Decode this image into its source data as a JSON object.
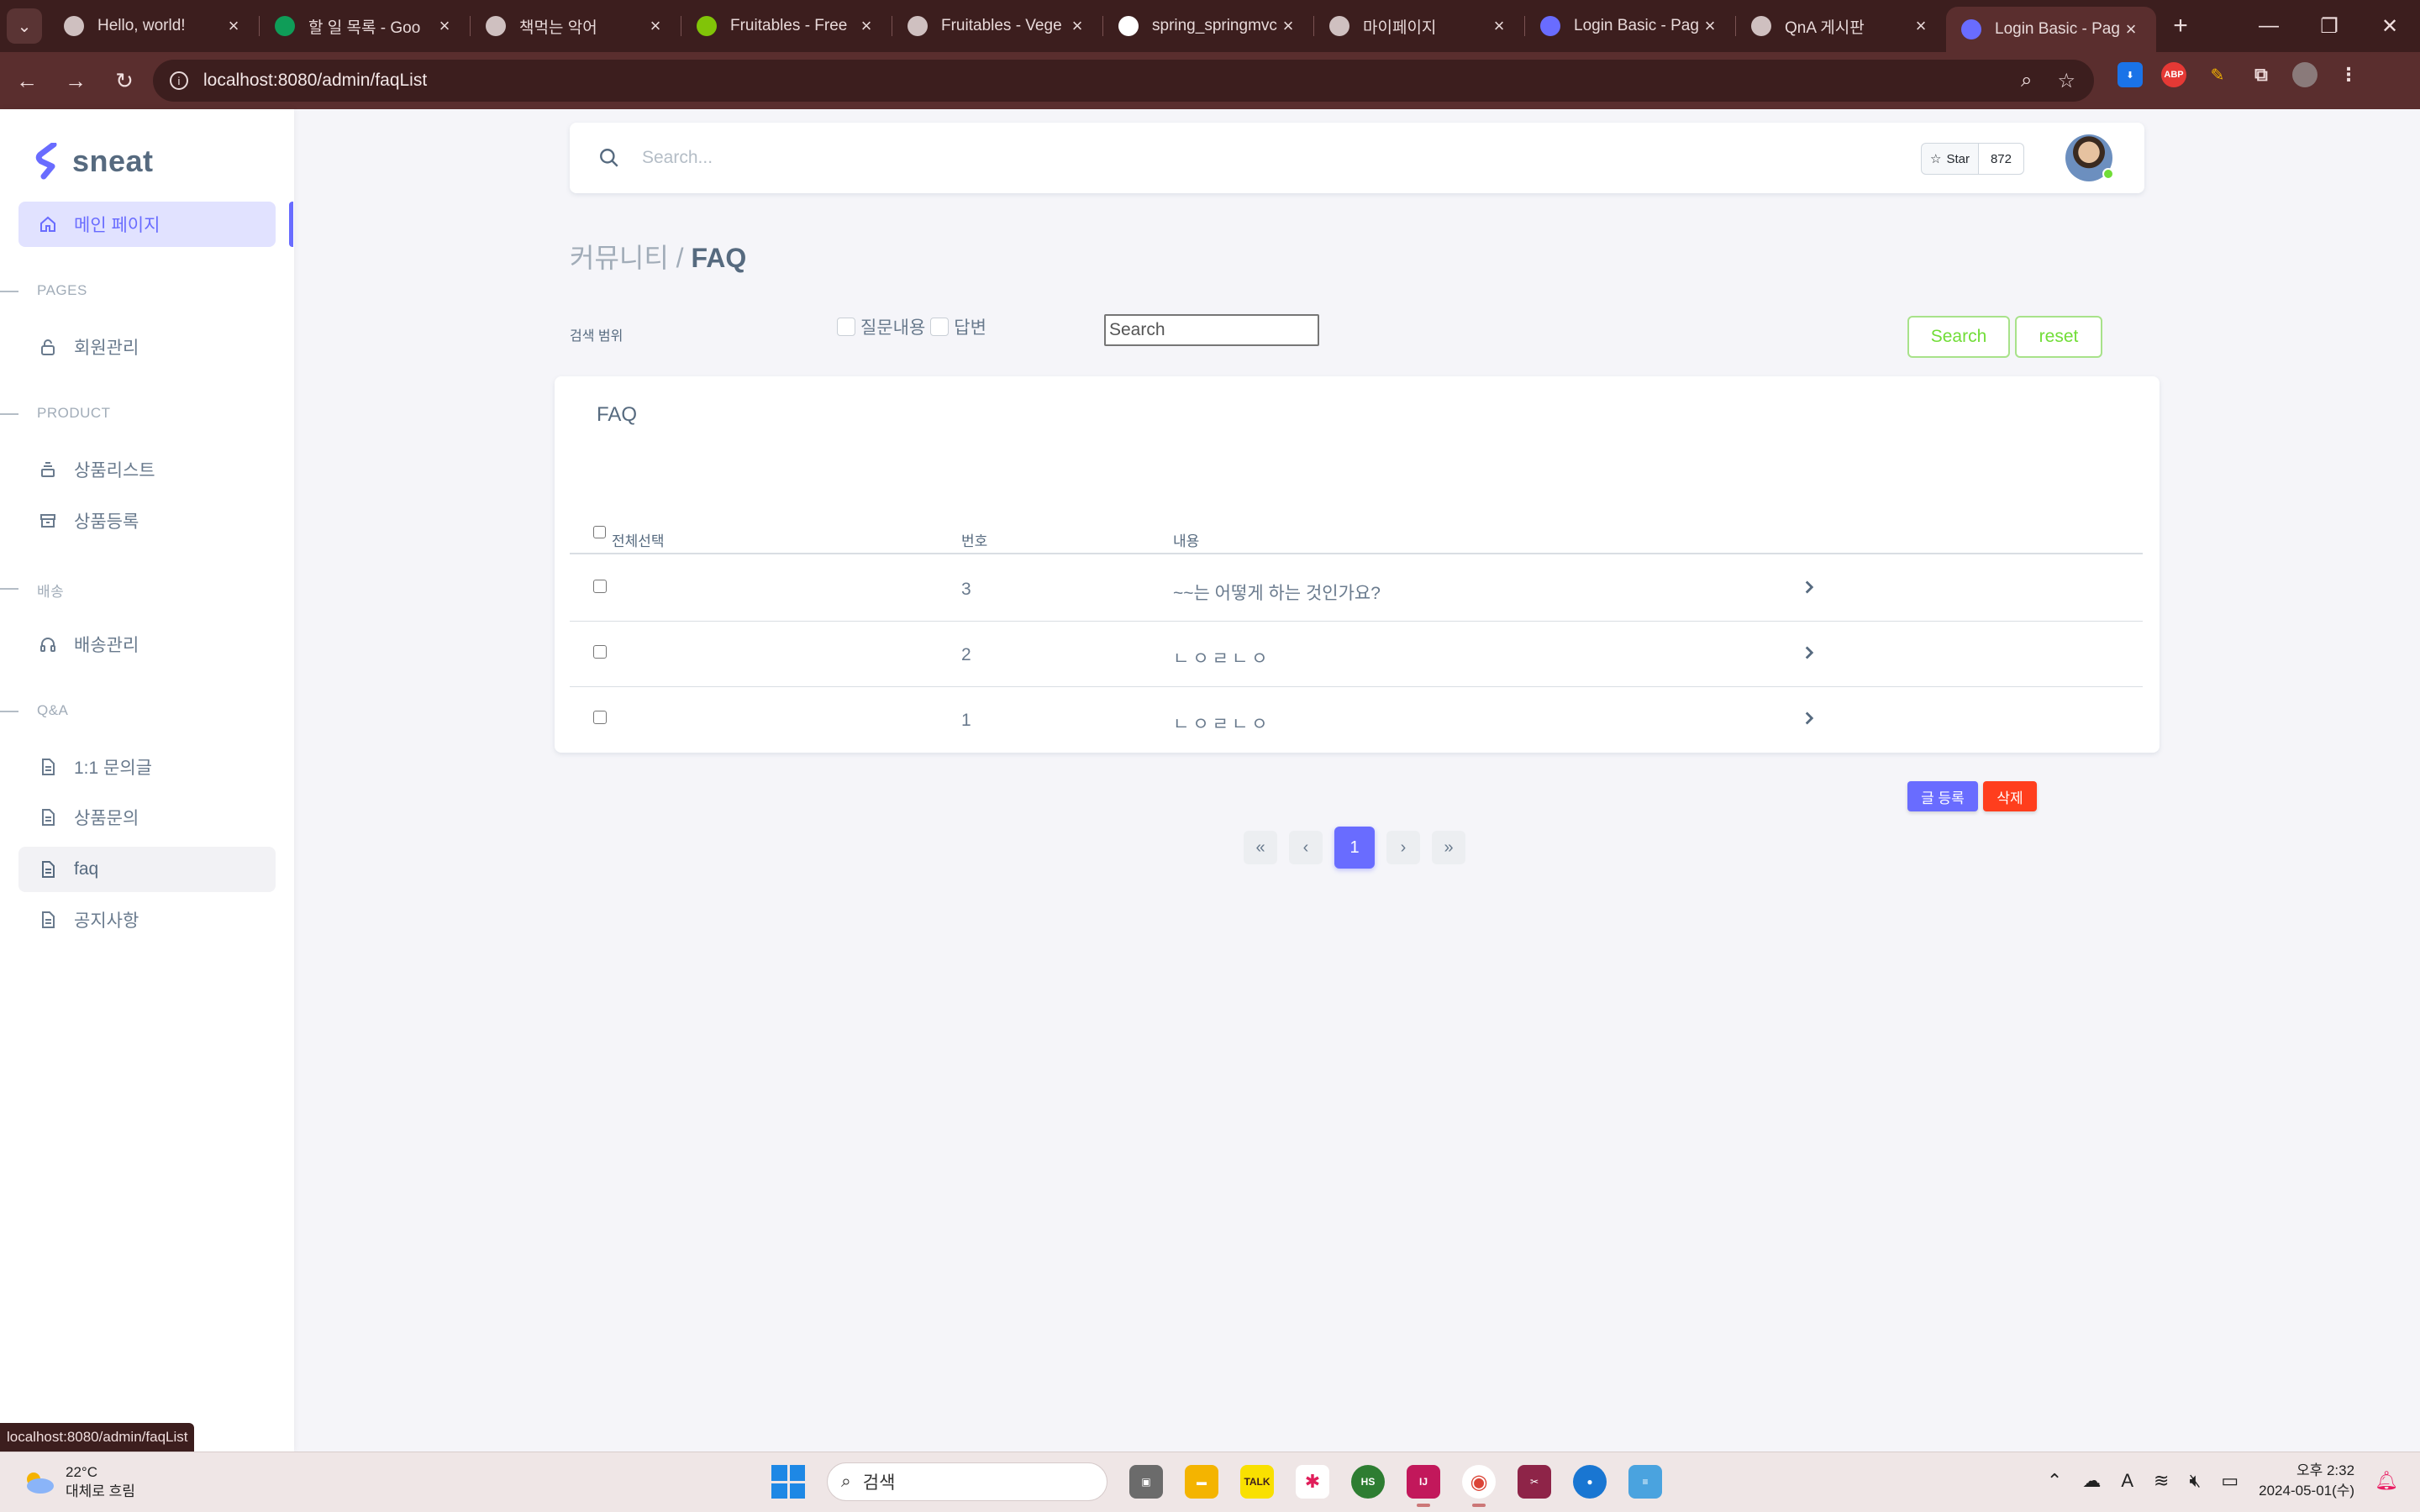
{
  "browser": {
    "tabs": [
      {
        "title": "Hello, world!",
        "icon": "globe-icon",
        "color": "#cfc0c0"
      },
      {
        "title": "할 일 목록 - Goo",
        "icon": "sheets-icon",
        "color": "#0f9d58"
      },
      {
        "title": "책먹는 악어",
        "icon": "globe-icon",
        "color": "#cfc0c0"
      },
      {
        "title": "Fruitables - Free",
        "icon": "leaf-icon",
        "color": "#81c408"
      },
      {
        "title": "Fruitables - Vege",
        "icon": "globe-icon",
        "color": "#cfc0c0"
      },
      {
        "title": "spring_springmvc",
        "icon": "github-icon",
        "color": "#ffffff"
      },
      {
        "title": "마이페이지",
        "icon": "globe-icon",
        "color": "#cfc0c0"
      },
      {
        "title": "Login Basic - Pag",
        "icon": "sneat-icon",
        "color": "#696cff"
      },
      {
        "title": "QnA 게시판",
        "icon": "globe-icon",
        "color": "#cfc0c0"
      },
      {
        "title": "Login Basic - Pag",
        "icon": "sneat-icon",
        "color": "#696cff",
        "active": true
      }
    ],
    "url": "localhost:8080/admin/faqList",
    "status_link": "localhost:8080/admin/faqList"
  },
  "sidebar": {
    "brand": "sneat",
    "main_item": "메인 페이지",
    "sections": {
      "pages": "PAGES",
      "product": "PRODUCT",
      "delivery": "배송",
      "qna": "Q&A"
    },
    "items": {
      "members": "회원관리",
      "product_list": "상품리스트",
      "product_register": "상품등록",
      "delivery_manage": "배송관리",
      "inquiry": "1:1 문의글",
      "product_inquiry": "상품문의",
      "faq": "faq",
      "notice": "공지사항"
    }
  },
  "navbar": {
    "search_placeholder": "Search...",
    "star_label": "Star",
    "star_count": "872"
  },
  "page": {
    "breadcrumb_parent": "커뮤니티 /",
    "breadcrumb_current": "FAQ",
    "filter_label": "검색 범위",
    "filter_question": "질문내용",
    "filter_answer": "답변",
    "search_placeholder": "Search",
    "search_button": "Search",
    "reset_button": "reset",
    "card_title": "FAQ",
    "columns": {
      "select_all": "전체선택",
      "number": "번호",
      "content": "내용"
    },
    "rows": [
      {
        "number": "3",
        "content": "~~는 어떻게 하는 것인가요?"
      },
      {
        "number": "2",
        "content": "ㄴㅇㄹㄴㅇ"
      },
      {
        "number": "1",
        "content": "ㄴㅇㄹㄴㅇ"
      }
    ],
    "write_button": "글 등록",
    "delete_button": "삭제",
    "pagination": {
      "first": "«",
      "prev": "‹",
      "current": "1",
      "next": "›",
      "last": "»"
    }
  },
  "taskbar": {
    "temperature": "22°C",
    "weather": "대체로 흐림",
    "search_label": "검색",
    "time": "오후 2:32",
    "date": "2024-05-01(수)"
  },
  "colors": {
    "primary": "#696cff",
    "success": "#71dd37",
    "danger": "#ff3e1d",
    "browser_frame": "#3c1e1e"
  }
}
